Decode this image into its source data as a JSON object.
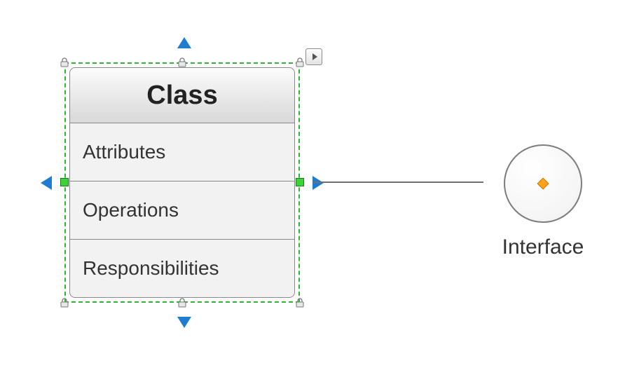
{
  "class_node": {
    "title": "Class",
    "compartments": [
      "Attributes",
      "Operations",
      "Responsibilities"
    ],
    "selected": true
  },
  "interface_node": {
    "label": "Interface"
  },
  "colors": {
    "selection": "#2fb82f",
    "arrow": "#1e7dd0",
    "lock": "#8a8a8a"
  }
}
